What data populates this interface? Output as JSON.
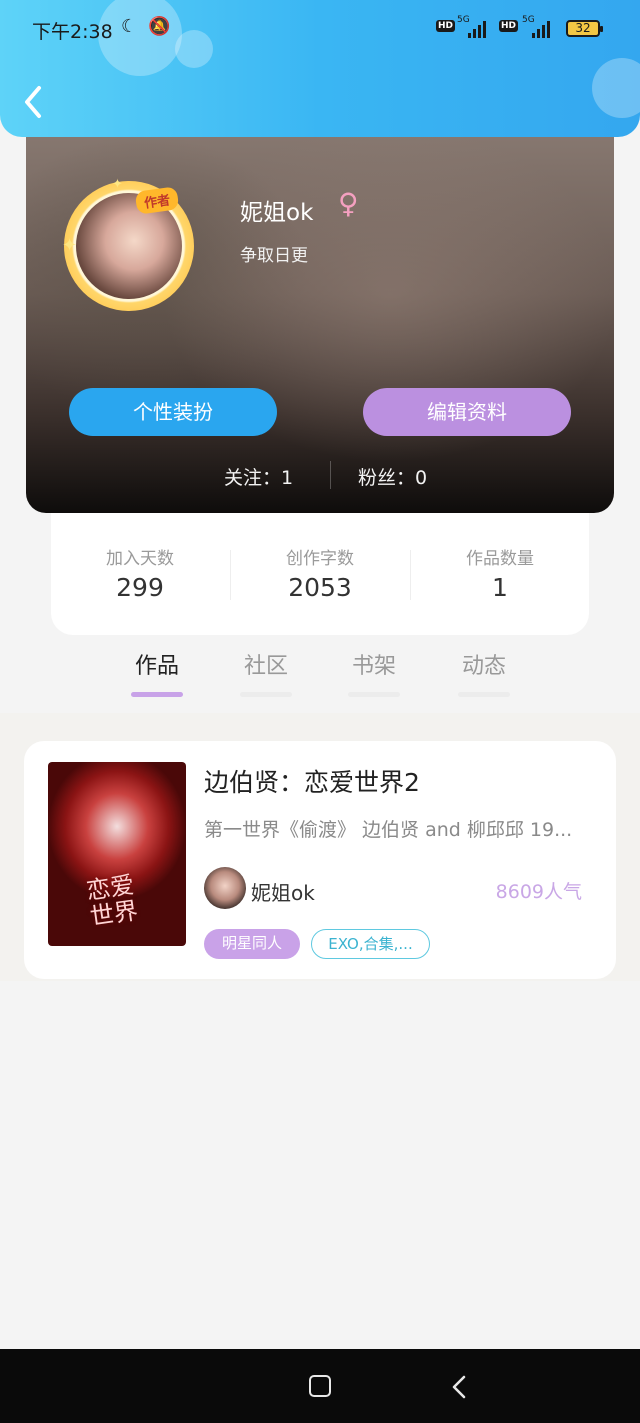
{
  "status_bar": {
    "time": "下午2:38",
    "network_1": "5G",
    "network_2": "5G",
    "hd_1": "HD",
    "hd_2": "HD",
    "battery": "32"
  },
  "profile": {
    "username": "妮姐ok",
    "gender_symbol": "♀",
    "signature": "争取日更",
    "author_badge": "作者",
    "buttons": {
      "dress_up": "个性装扮",
      "edit_profile": "编辑资料"
    },
    "following": "关注：1",
    "followers": "粉丝：0"
  },
  "stats": [
    {
      "label": "加入天数",
      "value": "299"
    },
    {
      "label": "创作字数",
      "value": "2053"
    },
    {
      "label": "作品数量",
      "value": "1"
    }
  ],
  "tabs": [
    {
      "label": "作品",
      "active": true
    },
    {
      "label": "社区",
      "active": false
    },
    {
      "label": "书架",
      "active": false
    },
    {
      "label": "动态",
      "active": false
    }
  ],
  "works": [
    {
      "title": "边伯贤：恋爱世界2",
      "description": "第一世界《偷渡》 边伯贤 and 柳邱邱 19...",
      "cover_text": "恋爱世界",
      "author": "妮姐ok",
      "popularity": "8609人气",
      "tags": [
        "明星同人",
        "EXO,合集,..."
      ]
    }
  ],
  "colors": {
    "header_blue": "#3ab6f3",
    "accent_purple": "#bb90e0",
    "accent_blue": "#2aa6ef"
  }
}
